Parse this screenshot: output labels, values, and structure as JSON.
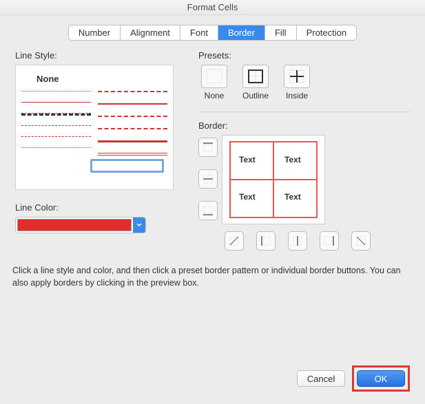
{
  "title": "Format Cells",
  "tabs": [
    "Number",
    "Alignment",
    "Font",
    "Border",
    "Fill",
    "Protection"
  ],
  "active_tab": "Border",
  "left": {
    "line_style_label": "Line Style:",
    "none_label": "None",
    "line_color_label": "Line Color:",
    "color_hex": "#df2e2b"
  },
  "right": {
    "presets_label": "Presets:",
    "presets": [
      "None",
      "Outline",
      "Inside"
    ],
    "border_label": "Border:",
    "cell_text": "Text"
  },
  "hint": "Click a line style and color, and then click a preset border pattern or individual border buttons. You can also apply borders by clicking in the preview box.",
  "buttons": {
    "cancel": "Cancel",
    "ok": "OK"
  }
}
